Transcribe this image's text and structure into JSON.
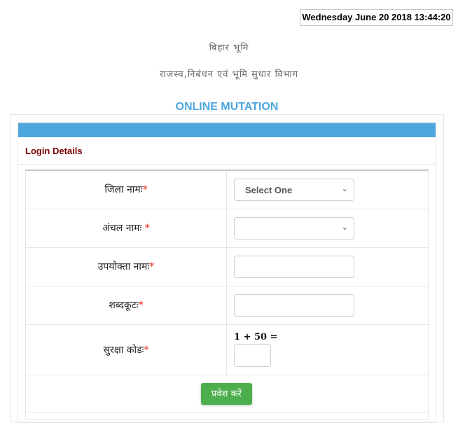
{
  "datetime": "Wednesday June 20 2018 13:44:20",
  "header": {
    "org_name": "बिहार भूमि",
    "department": "राजस्व,निबंधन एवं भूमि सुधार विभाग",
    "app_title": "ONLINE MUTATION"
  },
  "panel": {
    "title": "Login Details",
    "accent_color": "#4ea6df"
  },
  "form": {
    "required_marker": "*",
    "district": {
      "label": "जिला नामः",
      "selected": "Select One",
      "chevron": "⌄"
    },
    "circle": {
      "label": "अंचल नामः ",
      "selected": "",
      "chevron": "⌄"
    },
    "username": {
      "label": "उपयोक्ता नामः",
      "value": ""
    },
    "password": {
      "label": "शब्दकूटः",
      "value": ""
    },
    "captcha": {
      "label": "सुरक्षा कोडः",
      "question": "1 + 50 =",
      "value": ""
    },
    "submit_label": "प्रवेश करें",
    "submit_color": "#4cae4c"
  }
}
